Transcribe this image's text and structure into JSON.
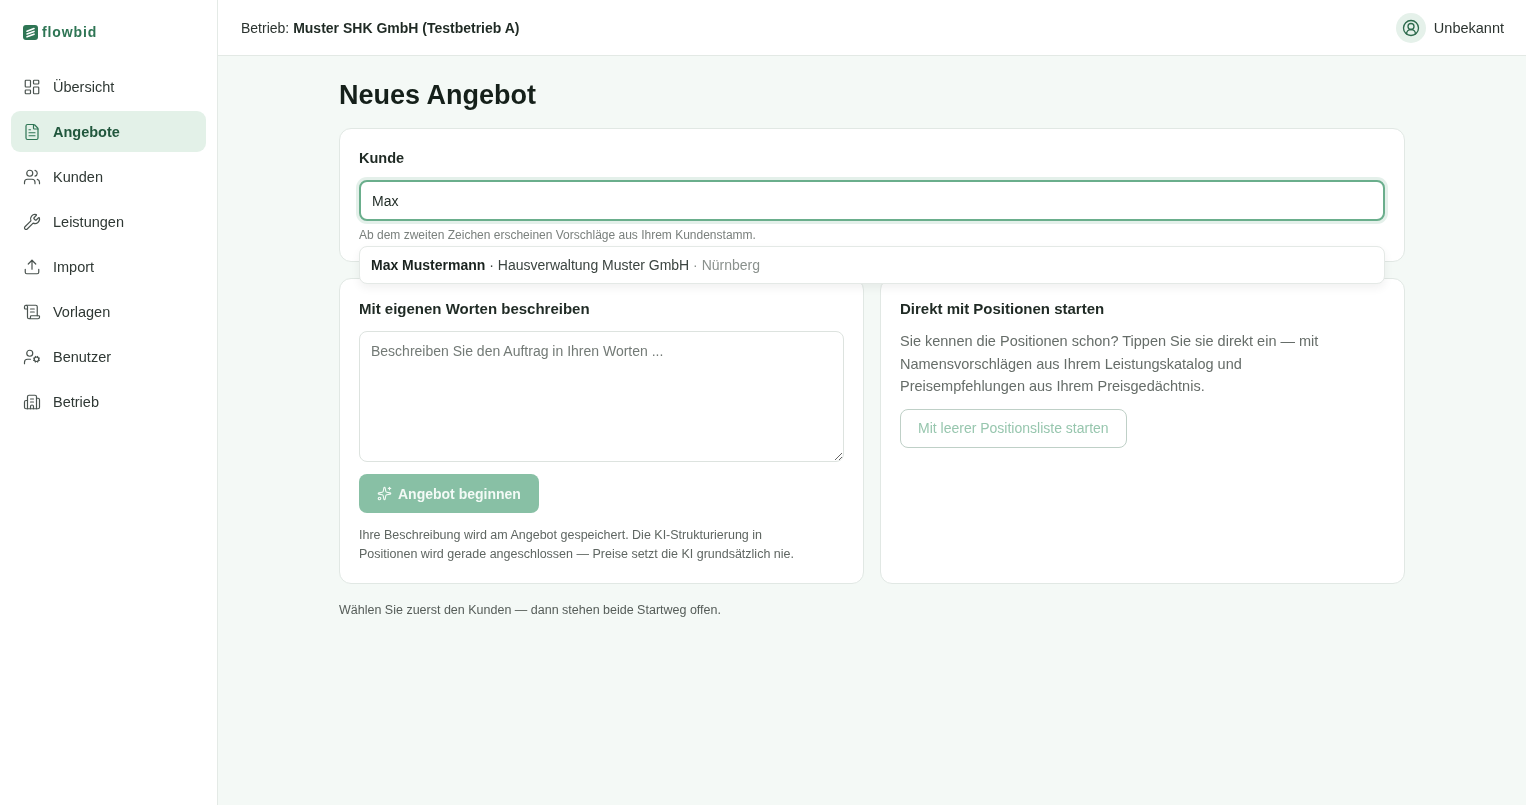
{
  "sidebar": {
    "brand": "flowbid",
    "items": [
      {
        "label": "Übersicht",
        "selected": false
      },
      {
        "label": "Angebote",
        "selected": true
      },
      {
        "label": "Kunden",
        "selected": false
      },
      {
        "label": "Leistungen",
        "selected": false
      },
      {
        "label": "Import",
        "selected": false
      },
      {
        "label": "Vorlagen",
        "selected": false
      },
      {
        "label": "Benutzer",
        "selected": false
      },
      {
        "label": "Betrieb",
        "selected": false
      }
    ]
  },
  "topbar": {
    "business": "Betrieb: **Muster SHK GmbH (Testbetrieb A)**",
    "user": "Unbekannt"
  },
  "page_title": "Neues Angebot",
  "customer": {
    "label": "Kunde",
    "value": "Max",
    "focused": true,
    "hint": "Ab dem zweiten Zeichen erscheinen Vorschläge aus Ihrem Kundenstamm.",
    "suggestions": [
      {
        "name": "Max Mustermann",
        "company": "· Hausverwaltung Muster GmbH",
        "city": "· Nürnberg"
      }
    ]
  },
  "describe": {
    "title": "Mit eigenen Worten beschreiben",
    "placeholder": "Beschreiben Sie den Auftrag in Ihren Worten ...",
    "button": {
      "label": "Angebot beginnen",
      "disabled": true
    },
    "note": "Ihre Beschreibung wird am Angebot gespeichert. Die KI-Strukturierung in Positionen wird gerade angeschlossen — Preise setzt die KI grundsätzlich nie."
  },
  "direct": {
    "title": "Direkt mit Positionen starten",
    "text": "Sie kennen die Positionen schon? Tippen Sie sie direkt ein — mit Namensvorschlägen aus Ihrem Leistungskatalog und Preisempfehlungen aus Ihrem Preisgedächtnis.",
    "button": {
      "label": "Mit leerer Positionsliste starten",
      "disabled": true
    }
  },
  "footer_note": "Wählen Sie zuerst den Kunden — dann stehen beide Startweg offen."
}
